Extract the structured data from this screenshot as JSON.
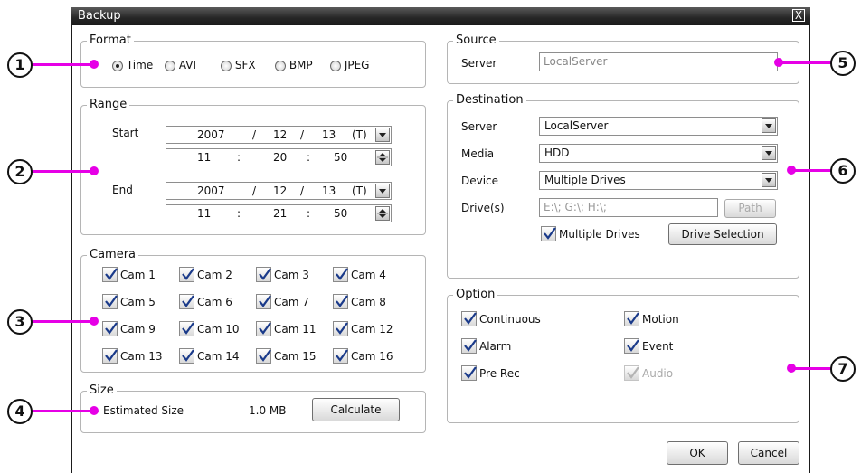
{
  "window": {
    "title": "Backup",
    "close_label": "X"
  },
  "format": {
    "legend": "Format",
    "options": [
      "Time",
      "AVI",
      "SFX",
      "BMP",
      "JPEG"
    ],
    "selected": "Time"
  },
  "range": {
    "legend": "Range",
    "start_label": "Start",
    "end_label": "End",
    "start": {
      "year": "2007",
      "month": "12",
      "day": "13",
      "t": "(T)",
      "hour": "11",
      "min": "20",
      "sec": "50"
    },
    "end": {
      "year": "2007",
      "month": "12",
      "day": "13",
      "t": "(T)",
      "hour": "11",
      "min": "21",
      "sec": "50"
    },
    "date_sep": "/",
    "time_sep": ":"
  },
  "camera": {
    "legend": "Camera",
    "cams": [
      "Cam 1",
      "Cam 2",
      "Cam 3",
      "Cam 4",
      "Cam 5",
      "Cam 6",
      "Cam 7",
      "Cam 8",
      "Cam 9",
      "Cam 10",
      "Cam 11",
      "Cam 12",
      "Cam 13",
      "Cam 14",
      "Cam 15",
      "Cam 16"
    ]
  },
  "size": {
    "legend": "Size",
    "label": "Estimated Size",
    "value": "1.0 MB",
    "calculate": "Calculate"
  },
  "source": {
    "legend": "Source",
    "server_label": "Server",
    "server_value": "LocalServer"
  },
  "destination": {
    "legend": "Destination",
    "server_label": "Server",
    "server_value": "LocalServer",
    "media_label": "Media",
    "media_value": "HDD",
    "device_label": "Device",
    "device_value": "Multiple Drives",
    "drives_label": "Drive(s)",
    "drives_value": "E:\\; G:\\; H:\\;",
    "path_button": "Path",
    "multiple_drives": "Multiple Drives",
    "drive_selection": "Drive Selection"
  },
  "option": {
    "legend": "Option",
    "continuous": "Continuous",
    "motion": "Motion",
    "alarm": "Alarm",
    "event": "Event",
    "prerec": "Pre Rec",
    "audio": "Audio"
  },
  "buttons": {
    "ok": "OK",
    "cancel": "Cancel"
  },
  "callouts": [
    "1",
    "2",
    "3",
    "4",
    "5",
    "6",
    "7"
  ],
  "colors": {
    "callout": "#e600e6",
    "titlebar": "#262626"
  }
}
